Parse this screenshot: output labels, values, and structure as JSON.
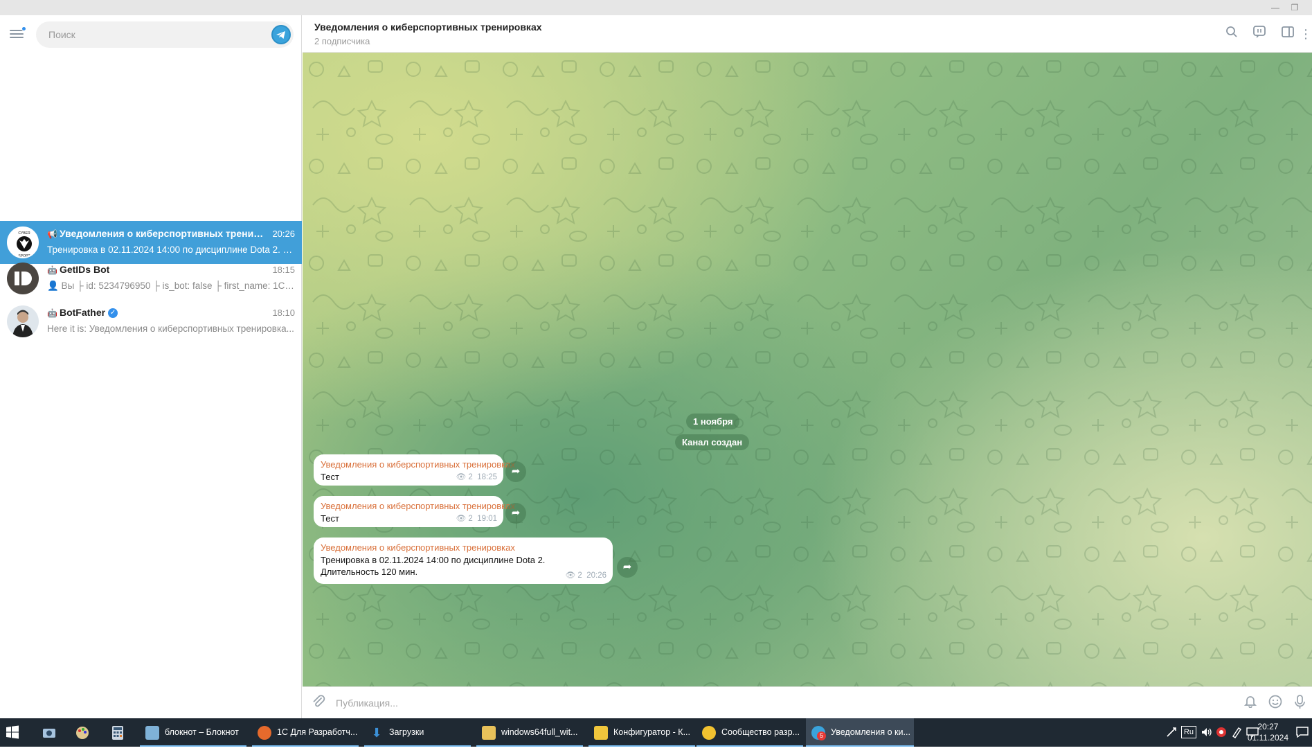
{
  "sidebar": {
    "search_placeholder": "Поиск",
    "chats": [
      {
        "name": "Уведомления о киберспортивных тренировк...",
        "time": "20:26",
        "preview": "Тренировка в 02.11.2024 14:00 по дисциплине Dota 2. Дл...",
        "type_icon": "megaphone-icon",
        "active": true
      },
      {
        "name": "GetIDs Bot",
        "time": "18:15",
        "preview": "👤 Вы  ├ id: 5234796950  ├ is_bot: false  ├ first_name: 1С  ├...",
        "type_icon": "bot-icon",
        "active": false
      },
      {
        "name": "BotFather",
        "time": "18:10",
        "preview": "Here it is: Уведомления о киберспортивных тренировка...",
        "type_icon": "bot-icon",
        "verified": true,
        "active": false
      }
    ]
  },
  "header": {
    "title": "Уведомления о киберспортивных тренировках",
    "subtitle": "2 подписчика"
  },
  "messages": {
    "date_badge": "1 ноября",
    "service_created": "Канал создан",
    "items": [
      {
        "author": "Уведомления о киберспортивных тренировках",
        "text_lines": [
          "Тест"
        ],
        "views": "2",
        "time": "18:25"
      },
      {
        "author": "Уведомления о киберспортивных тренировках",
        "text_lines": [
          "Тест"
        ],
        "views": "2",
        "time": "19:01"
      },
      {
        "author": "Уведомления о киберспортивных тренировках",
        "text_lines": [
          "Тренировка в 02.11.2024 14:00 по дисциплине Dota 2.",
          "Длительность 120 мин."
        ],
        "views": "2",
        "time": "20:26"
      }
    ]
  },
  "composer": {
    "placeholder": "Публикация..."
  },
  "taskbar": {
    "apps": [
      {
        "label": "блокнот – Блокнот",
        "icon_color": "#7fb2d8"
      },
      {
        "label": "1С Для Разработч...",
        "icon_color": "#e66a2c"
      },
      {
        "label": "Загрузки",
        "icon_color": "#3b8fd6"
      },
      {
        "label": "windows64full_wit...",
        "icon_color": "#e8c15a"
      },
      {
        "label": "Конфигуратор - К...",
        "icon_color": "#f0c63c"
      },
      {
        "label": "Сообщество разр...",
        "icon_color": "#f2c230"
      },
      {
        "label": "Уведомления о ки...",
        "icon_color": "#3aa3dc",
        "active": true,
        "badge": "5"
      }
    ],
    "lang": "Ru",
    "time": "20:27",
    "date": "01.11.2024"
  },
  "colors": {
    "active_chat": "#419fd9",
    "author": "#d9703a",
    "accent": "#3390ec"
  }
}
